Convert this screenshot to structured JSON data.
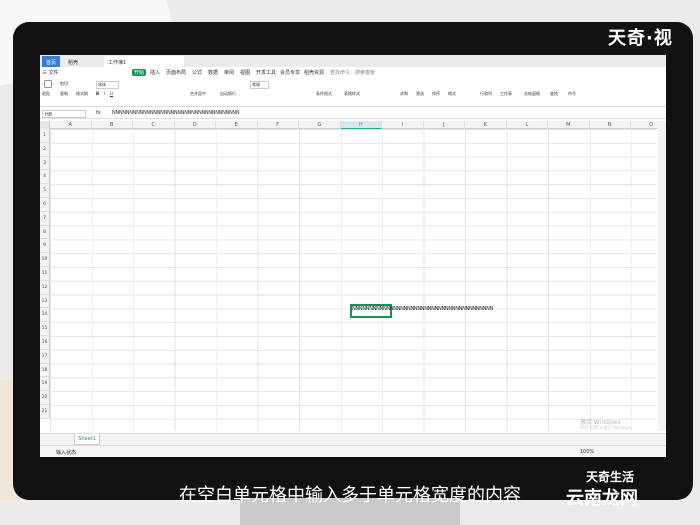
{
  "brand": {
    "top_right": "天奇·视",
    "bottom_small": "天奇生活",
    "bottom_large": "云南龙网"
  },
  "subtitle": "在空白单元格中输入多于单元格宽度的内容",
  "tabs": [
    {
      "label": "首页"
    },
    {
      "label": "稻壳"
    },
    {
      "label": "工作簿1"
    }
  ],
  "menu": [
    "三 文件",
    "开始",
    "插入",
    "页面布局",
    "公式",
    "数据",
    "审阅",
    "视图",
    "开发工具",
    "会员专享",
    "稻壳资源",
    "查找命令、搜索模板"
  ],
  "ribbon": [
    "粘贴",
    "剪切",
    "复制",
    "格式刷",
    "宋体",
    "合并居中",
    "自动换行",
    "常规",
    "条件格式",
    "表格样式",
    "求和",
    "筛选",
    "排序",
    "格式",
    "行和列",
    "工作表",
    "冻结窗格",
    "查找",
    "符号"
  ],
  "formula_bar": {
    "cell_ref": "H8",
    "fx": "fx",
    "content": "NNNNNNNNNNNNNNNNNNNNNNNNNNNNNNNNNNNNN"
  },
  "columns": [
    "A",
    "B",
    "C",
    "D",
    "E",
    "F",
    "G",
    "H",
    "I",
    "J",
    "K",
    "L",
    "M",
    "N",
    "O"
  ],
  "active_column": "H",
  "rows": [
    "1",
    "2",
    "3",
    "4",
    "5",
    "6",
    "7",
    "8",
    "9",
    "10",
    "11",
    "12",
    "13",
    "14",
    "15",
    "16",
    "17",
    "18",
    "19",
    "20",
    "21"
  ],
  "cell": {
    "ref": "H8",
    "text": "NNNNNNNNNNNNNNNNNNNNNNNNNNNNNNNNNNNNNNNNN"
  },
  "sheet_tabs": [
    "Sheet1"
  ],
  "status": {
    "left": "输入状态",
    "zoom": "100%"
  },
  "watermark": {
    "line1": "激活 Windows",
    "line2": "转到\"设置\"以激活 Windows。"
  }
}
